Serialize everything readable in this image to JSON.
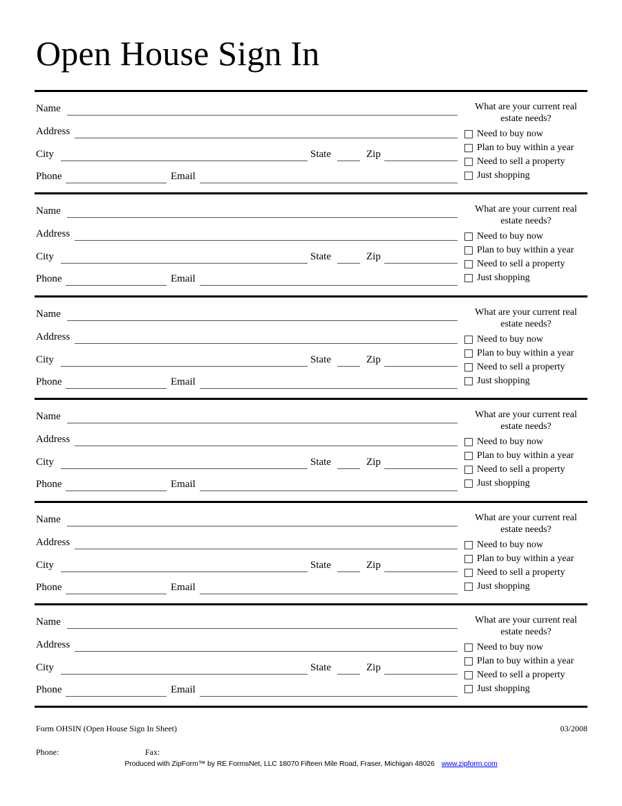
{
  "document": {
    "title": "Open House Sign In"
  },
  "labels": {
    "name": "Name",
    "address": "Address",
    "city": "City",
    "state": "State",
    "zip": "Zip",
    "phone": "Phone",
    "email": "Email"
  },
  "needs": {
    "heading": "What are your current real estate needs?",
    "options": [
      "Need to buy now",
      "Plan to buy within a year",
      "Need to sell a property",
      "Just shopping"
    ]
  },
  "entries_count": 6,
  "footer": {
    "form_id": "Form OHSIN (Open House Sign In Sheet)",
    "revision_date": "03/2008",
    "phone_label": "Phone:",
    "fax_label": "Fax:",
    "produced_text": "Produced with ZipForm™ by RE FormsNet, LLC 18070 Fifteen Mile Road, Fraser, Michigan 48026",
    "produced_url": "www.zipform.com"
  },
  "colors": {
    "ink": "#000000",
    "rule": "#000000",
    "field_line": "#555555",
    "checkbox_border": "#3a3a3a",
    "background": "#ffffff"
  }
}
